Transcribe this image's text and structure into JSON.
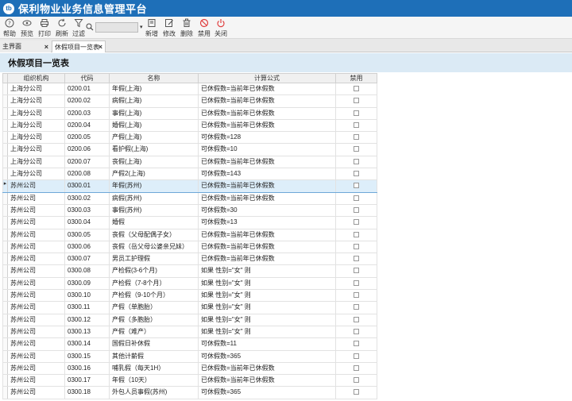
{
  "app": {
    "title": "保利物业业务信息管理平台",
    "logo_text": "tb"
  },
  "toolbar": {
    "help": "帮助",
    "preview": "预览",
    "print": "打印",
    "refresh": "刷新",
    "filter": "过滤",
    "new": "新增",
    "edit": "修改",
    "delete": "删除",
    "disable": "禁用",
    "close": "关闭",
    "search_value": "",
    "search_dropdown": "▾"
  },
  "tabs": [
    {
      "label": "主界面",
      "close": "×"
    },
    {
      "label": "休假项目一览表",
      "close": "×"
    }
  ],
  "page": {
    "title": "休假项目一览表"
  },
  "grid": {
    "columns": [
      "组织机构",
      "代码",
      "名称",
      "计算公式",
      "禁用"
    ],
    "selected_marker": "▸",
    "rows": [
      {
        "org": "上海分公司",
        "code": "0200.01",
        "name": "年假(上海)",
        "formula": "已休假数=当前年已休假数"
      },
      {
        "org": "上海分公司",
        "code": "0200.02",
        "name": "病假(上海)",
        "formula": "已休假数=当前年已休假数"
      },
      {
        "org": "上海分公司",
        "code": "0200.03",
        "name": "事假(上海)",
        "formula": "已休假数=当前年已休假数"
      },
      {
        "org": "上海分公司",
        "code": "0200.04",
        "name": "婚假(上海)",
        "formula": "已休假数=当前年已休假数"
      },
      {
        "org": "上海分公司",
        "code": "0200.05",
        "name": "产假(上海)",
        "formula": "可休假数=128"
      },
      {
        "org": "上海分公司",
        "code": "0200.06",
        "name": "看护假(上海)",
        "formula": "可休假数=10"
      },
      {
        "org": "上海分公司",
        "code": "0200.07",
        "name": "丧假(上海)",
        "formula": "已休假数=当前年已休假数"
      },
      {
        "org": "上海分公司",
        "code": "0200.08",
        "name": "产假2(上海)",
        "formula": "可休假数=143"
      },
      {
        "org": "苏州公司",
        "code": "0300.01",
        "name": "年假(苏州)",
        "formula": "已休假数=当前年已休假数"
      },
      {
        "org": "苏州公司",
        "code": "0300.02",
        "name": "病假(苏州)",
        "formula": "已休假数=当前年已休假数"
      },
      {
        "org": "苏州公司",
        "code": "0300.03",
        "name": "事假(苏州)",
        "formula": "可休假数=30"
      },
      {
        "org": "苏州公司",
        "code": "0300.04",
        "name": "婚假",
        "formula": "可休假数=13"
      },
      {
        "org": "苏州公司",
        "code": "0300.05",
        "name": "丧假（父母配偶子女）",
        "formula": "已休假数=当前年已休假数"
      },
      {
        "org": "苏州公司",
        "code": "0300.06",
        "name": "丧假（岳父母公婆亲兄妹）",
        "formula": "已休假数=当前年已休假数"
      },
      {
        "org": "苏州公司",
        "code": "0300.07",
        "name": "男员工护理假",
        "formula": "已休假数=当前年已休假数"
      },
      {
        "org": "苏州公司",
        "code": "0300.08",
        "name": "产检假(3-6个月)",
        "formula": "如果 性别=\"女\" 则"
      },
      {
        "org": "苏州公司",
        "code": "0300.09",
        "name": "产检假（7-8个月）",
        "formula": "如果 性别=\"女\" 则"
      },
      {
        "org": "苏州公司",
        "code": "0300.10",
        "name": "产检假（9-10个月）",
        "formula": "如果 性别=\"女\" 则"
      },
      {
        "org": "苏州公司",
        "code": "0300.11",
        "name": "产假（单胞胎）",
        "formula": "如果 性别=\"女\" 则"
      },
      {
        "org": "苏州公司",
        "code": "0300.12",
        "name": "产假（多胞胎）",
        "formula": "如果 性别=\"女\" 则"
      },
      {
        "org": "苏州公司",
        "code": "0300.13",
        "name": "产假（难产）",
        "formula": "如果 性别=\"女\" 则"
      },
      {
        "org": "苏州公司",
        "code": "0300.14",
        "name": "国假日补休假",
        "formula": "可休假数=11"
      },
      {
        "org": "苏州公司",
        "code": "0300.15",
        "name": "其他计薪假",
        "formula": "可休假数=365"
      },
      {
        "org": "苏州公司",
        "code": "0300.16",
        "name": "哺乳假（每天1H）",
        "formula": "已休假数=当前年已休假数"
      },
      {
        "org": "苏州公司",
        "code": "0300.17",
        "name": "年假（10天）",
        "formula": "已休假数=当前年已休假数"
      },
      {
        "org": "苏州公司",
        "code": "0300.18",
        "name": "外包人员事假(苏州)",
        "formula": "可休假数=365"
      }
    ]
  }
}
